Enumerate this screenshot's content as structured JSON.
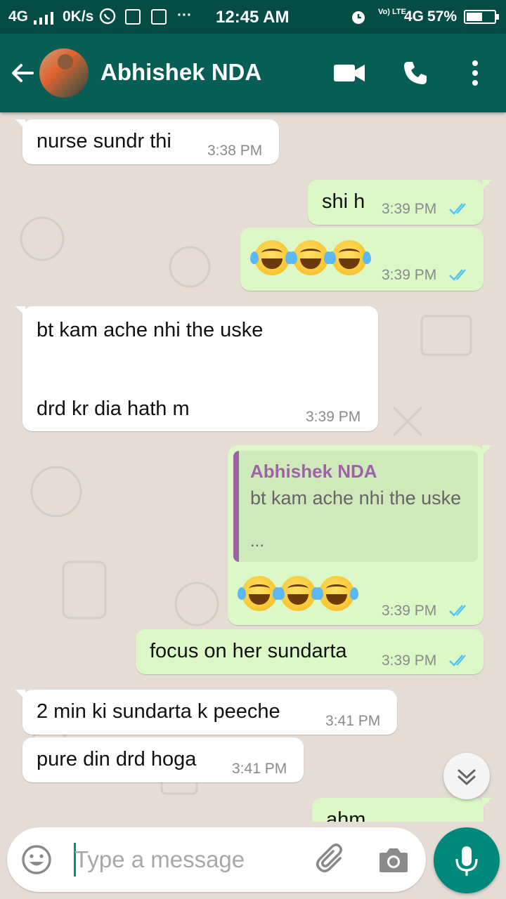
{
  "status_bar": {
    "network": "4G",
    "speed": "0K/s",
    "time": "12:45 AM",
    "volte": "Vo) LTE",
    "network2": "4G",
    "battery": "57%",
    "battery_level": 0.57,
    "dots": "···"
  },
  "header": {
    "contact_name": "Abhishek NDA"
  },
  "messages": [
    {
      "direction": "in",
      "text": "nurse sundr thi",
      "time": "3:38 PM"
    },
    {
      "direction": "out",
      "text": "shi h",
      "time": "3:39 PM",
      "ticks": "read"
    },
    {
      "direction": "out",
      "emoji": "😂😂😂",
      "time": "3:39 PM",
      "ticks": "read"
    },
    {
      "direction": "in",
      "line1": "bt kam ache nhi the uske",
      "line2": "drd kr dia hath m",
      "time": "3:39 PM"
    },
    {
      "direction": "out",
      "quote_author": "Abhishek NDA",
      "quote_text": "bt kam ache nhi the uske",
      "quote_ellipsis": "...",
      "emoji": "😂😂😂",
      "time": "3:39 PM",
      "ticks": "read"
    },
    {
      "direction": "out",
      "text": "focus on her sundarta",
      "time": "3:39 PM",
      "ticks": "read"
    },
    {
      "direction": "in",
      "text": "2 min ki sundarta k peeche",
      "time": "3:41 PM"
    },
    {
      "direction": "in",
      "text": "pure din drd hoga",
      "time": "3:41 PM"
    },
    {
      "direction": "out",
      "text": "ahm",
      "ticks": "read"
    }
  ],
  "composer": {
    "placeholder": "Type a message",
    "value": ""
  },
  "colors": {
    "status_bar": "#054d44",
    "app_bar": "#075e54",
    "chat_bg": "#e5ddd5",
    "outgoing_bubble": "#dcf8c6",
    "incoming_bubble": "#ffffff",
    "read_ticks": "#4fc3f7",
    "quote_author": "#9c64a6",
    "mic_button": "#00897b"
  },
  "icons": {
    "back": "arrow-left-icon",
    "video_call": "video-camera-icon",
    "voice_call": "phone-icon",
    "menu": "more-vertical-icon",
    "emoji": "smiley-icon",
    "attach": "paperclip-icon",
    "camera": "camera-icon",
    "mic": "microphone-icon",
    "scroll_down": "double-chevron-down-icon"
  }
}
